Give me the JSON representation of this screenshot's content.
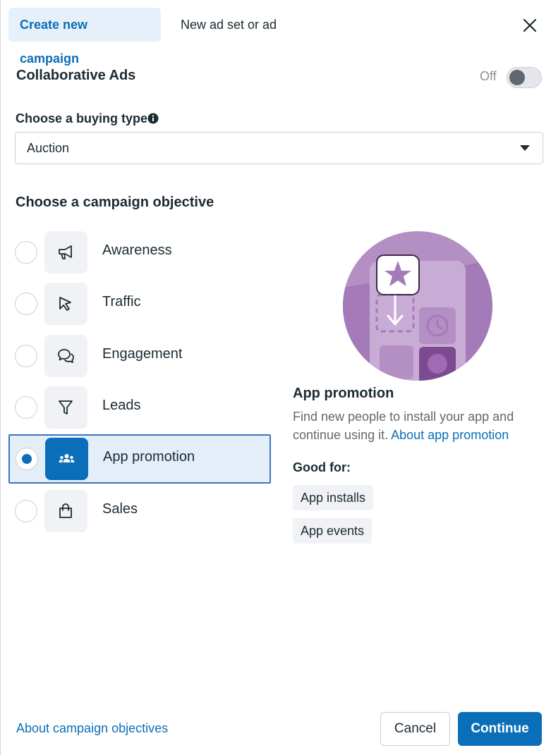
{
  "tabs": [
    {
      "label": "Create new campaign",
      "active": true
    },
    {
      "label": "New ad set or ad",
      "active": false
    }
  ],
  "collab": {
    "title": "Collaborative Ads",
    "toggle_state": "Off"
  },
  "buying": {
    "label": "Choose a buying type",
    "value": "Auction"
  },
  "objective": {
    "title": "Choose a campaign objective",
    "options": [
      {
        "label": "Awareness",
        "icon": "megaphone-icon",
        "selected": false
      },
      {
        "label": "Traffic",
        "icon": "cursor-icon",
        "selected": false
      },
      {
        "label": "Engagement",
        "icon": "chat-bubbles-icon",
        "selected": false
      },
      {
        "label": "Leads",
        "icon": "funnel-icon",
        "selected": false
      },
      {
        "label": "App promotion",
        "icon": "people-icon",
        "selected": true
      },
      {
        "label": "Sales",
        "icon": "shopping-bag-icon",
        "selected": false
      }
    ]
  },
  "detail": {
    "title": "App promotion",
    "description": "Find new people to install your app and continue using it.",
    "link": "About app promotion",
    "good_for_label": "Good for:",
    "chips": [
      "App installs",
      "App events"
    ]
  },
  "footer": {
    "link": "About campaign objectives",
    "cancel": "Cancel",
    "continue": "Continue"
  },
  "colors": {
    "accent": "#0a6fb8",
    "selected_bg": "#e3eef8",
    "illustration": "#b48fc4"
  }
}
